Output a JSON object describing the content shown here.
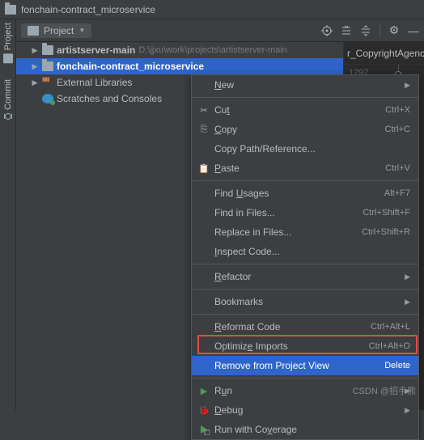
{
  "title": "fonchain-contract_microservice",
  "rail": {
    "project": "Project",
    "commit": "Commit"
  },
  "toolhead": {
    "view_label": "Project"
  },
  "editor": {
    "tab_label": "r_CopyrightAgency",
    "line_no": "1297"
  },
  "tree": {
    "items": [
      {
        "name": "artistserver-main",
        "path": "D:\\jjxu\\work\\projects\\artistserver-main"
      },
      {
        "name": "fonchain-contract_microservice",
        "path": ""
      },
      {
        "name": "External Libraries",
        "path": ""
      },
      {
        "name": "Scratches and Consoles",
        "path": ""
      }
    ]
  },
  "ctx": {
    "new": "New",
    "cut": "Cut",
    "cut_sc": "Ctrl+X",
    "copy": "Copy",
    "copy_sc": "Ctrl+C",
    "copy_path": "Copy Path/Reference...",
    "paste": "Paste",
    "paste_sc": "Ctrl+V",
    "find_usages": "Find Usages",
    "find_usages_sc": "Alt+F7",
    "find_files": "Find in Files...",
    "find_files_sc": "Ctrl+Shift+F",
    "replace_files": "Replace in Files...",
    "replace_files_sc": "Ctrl+Shift+R",
    "inspect": "Inspect Code...",
    "refactor": "Refactor",
    "bookmarks": "Bookmarks",
    "reformat": "Reformat Code",
    "reformat_sc": "Ctrl+Alt+L",
    "optimize": "Optimize Imports",
    "optimize_sc": "Ctrl+Alt+O",
    "remove": "Remove from Project View",
    "remove_sc": "Delete",
    "run": "Run",
    "debug": "Debug",
    "run_cov": "Run with Coverage"
  },
  "watermark": "CSDN @招手熊"
}
